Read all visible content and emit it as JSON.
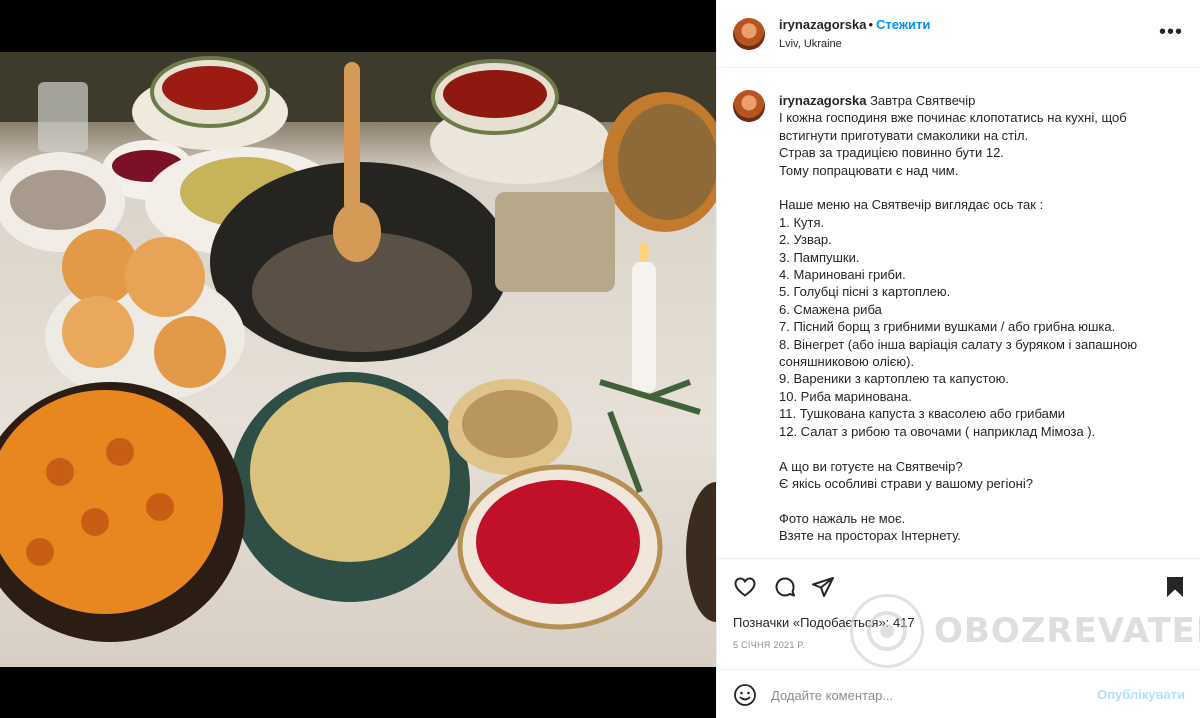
{
  "post": {
    "username": "irynazagorska",
    "follow_label": "Стежити",
    "location": "Lviv, Ukraine",
    "more_icon": "more-options-icon"
  },
  "caption": {
    "username": "irynazagorska",
    "title": "Завтра Святвечір",
    "intro_lines": [
      "І кожна господиня вже починає клопотатись на кухні, щоб",
      "встигнути приготувати смаколики на стіл.",
      "Страв за традицією повинно бути 12.",
      "Тому попрацювати є над чим."
    ],
    "menu_heading": "Наше меню на Святвечір виглядає ось так :",
    "menu_items": [
      "1. Кутя.",
      "2. Узвар.",
      "3. Пампушки.",
      "4. Мариновані гриби.",
      "5. Голубці пісні з картоплею.",
      "6. Смажена риба",
      "7. Пісний борщ з грибними вушками / або грибна юшка.",
      "8. Вінегрет (або інша варіація салату з буряком і запашною соняшниковою олією).",
      "9. Вареники з картоплею та капустою.",
      "10. Риба маринована.",
      "11. Тушкована капуста з квасолею або грибами",
      "12. Салат з рибою та овочами ( наприклад Мімоза )."
    ],
    "questions": [
      "А що ви готуєте на Святвечір?",
      "Є якісь особливі страви у вашому регіоні?"
    ],
    "footer_lines": [
      "Фото нажаль не моє.",
      "Взяте на просторах Інтернету."
    ]
  },
  "actions": {
    "likes_label": "Позначки «Подобається»:",
    "likes_count": "417",
    "date": "5 СІЧНЯ 2021 Р."
  },
  "comment": {
    "placeholder": "Додайте коментар...",
    "publish_label": "Опублікувати"
  },
  "watermark": {
    "text": "OBOZREVATEL"
  },
  "colors": {
    "accent": "#0095f6",
    "publish_disabled": "#b2dffc",
    "text": "#262626",
    "muted": "#8e8e8e"
  }
}
